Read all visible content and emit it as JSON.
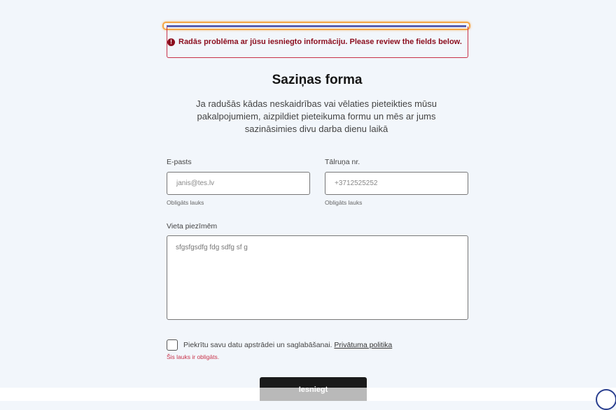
{
  "alert": {
    "message": "Radās problēma ar jūsu iesniegto informāciju. Please review the fields below.",
    "icon": "exclamation-circle-icon",
    "color": "#8b0e1e",
    "border_color": "#c8324a"
  },
  "form": {
    "title": "Saziņas forma",
    "intro": "Ja radušās kādas neskaidrības vai vēlaties pieteikties mūsu pakalpojumiem, aizpildiet pieteikuma formu un mēs ar jums sazināsimies divu darba dienu laikā",
    "email": {
      "label": "E-pasts",
      "value": "janis@tes.lv",
      "help": "Obligāts lauks"
    },
    "phone": {
      "label": "Tālruņa nr.",
      "value": "+3712525252",
      "help": "Obligāts lauks"
    },
    "notes": {
      "label": "Vieta piezīmēm",
      "value": "sfgsfgsdfg fdg sdfg sf g"
    },
    "consent": {
      "text": "Piekrītu savu datu apstrādei un saglabāšanai.",
      "link": "Privātuma politika",
      "error": "Šis lauks ir obligāts.",
      "checked": false
    },
    "submit_label": "Iesniegt"
  },
  "colors": {
    "background": "#f2f6fb",
    "focus_ring": "#f5a544",
    "error": "#c8324a",
    "button": "#1a1a1a"
  }
}
